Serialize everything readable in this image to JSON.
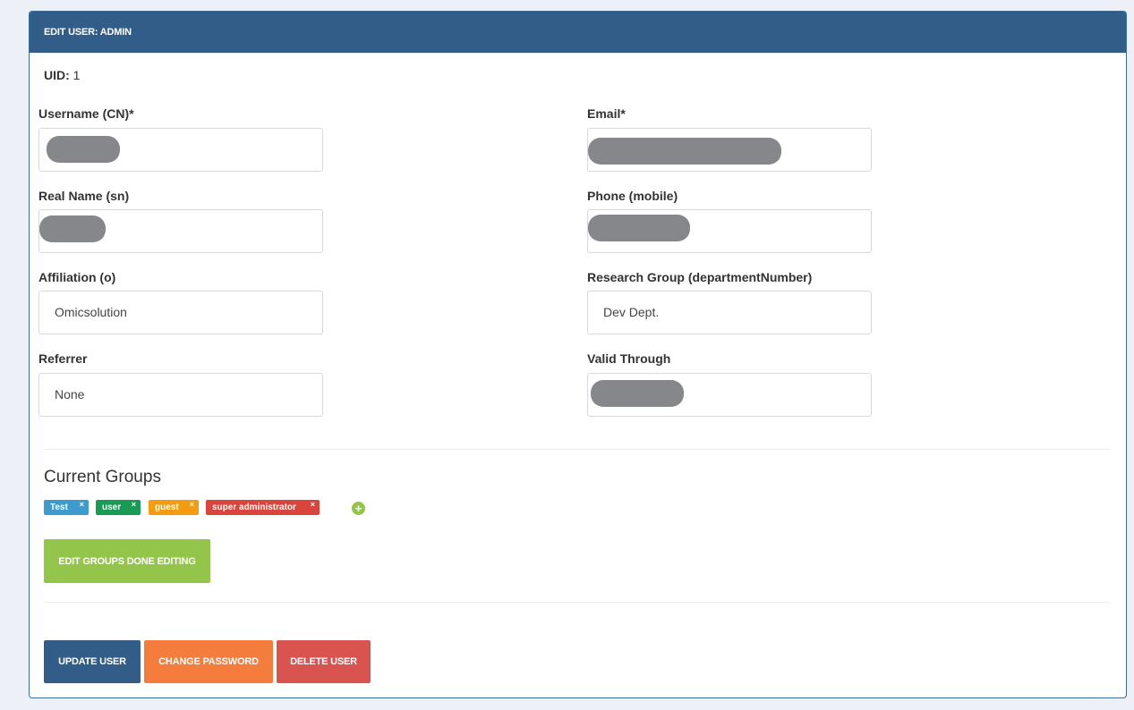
{
  "header": {
    "title": "EDIT USER: ADMIN"
  },
  "uid": {
    "label": "UID:",
    "value": "1"
  },
  "fields": {
    "username": {
      "label": "Username (CN)*",
      "value": ""
    },
    "email": {
      "label": "Email*",
      "value": ""
    },
    "realname": {
      "label": "Real Name (sn)",
      "value": ""
    },
    "phone": {
      "label": "Phone (mobile)",
      "value": ""
    },
    "affiliation": {
      "label": "Affiliation (o)",
      "value": "Omicsolution"
    },
    "research_group": {
      "label": "Research Group (departmentNumber)",
      "value": "Dev Dept."
    },
    "referrer": {
      "label": "Referrer",
      "value": "None"
    },
    "valid_through": {
      "label": "Valid Through",
      "value": ""
    }
  },
  "groups": {
    "title": "Current Groups",
    "tags": [
      {
        "label": "Test",
        "color": "#3e9bcd"
      },
      {
        "label": "user",
        "color": "#1a9b55"
      },
      {
        "label": "guest",
        "color": "#f39c12"
      },
      {
        "label": "super administrator",
        "color": "#d9443c"
      }
    ],
    "remove_glyph": "×",
    "add_glyph": "+",
    "edit_button": "EDIT GROUPS DONE EDITING"
  },
  "actions": {
    "update": "UPDATE USER",
    "change_password": "CHANGE PASSWORD",
    "delete": "DELETE USER"
  },
  "colors": {
    "header": "#325d88",
    "update": "#325d88",
    "change_password": "#f47c3c",
    "delete": "#d9534f",
    "edit_groups": "#93c54b",
    "redaction": "#86878a"
  }
}
